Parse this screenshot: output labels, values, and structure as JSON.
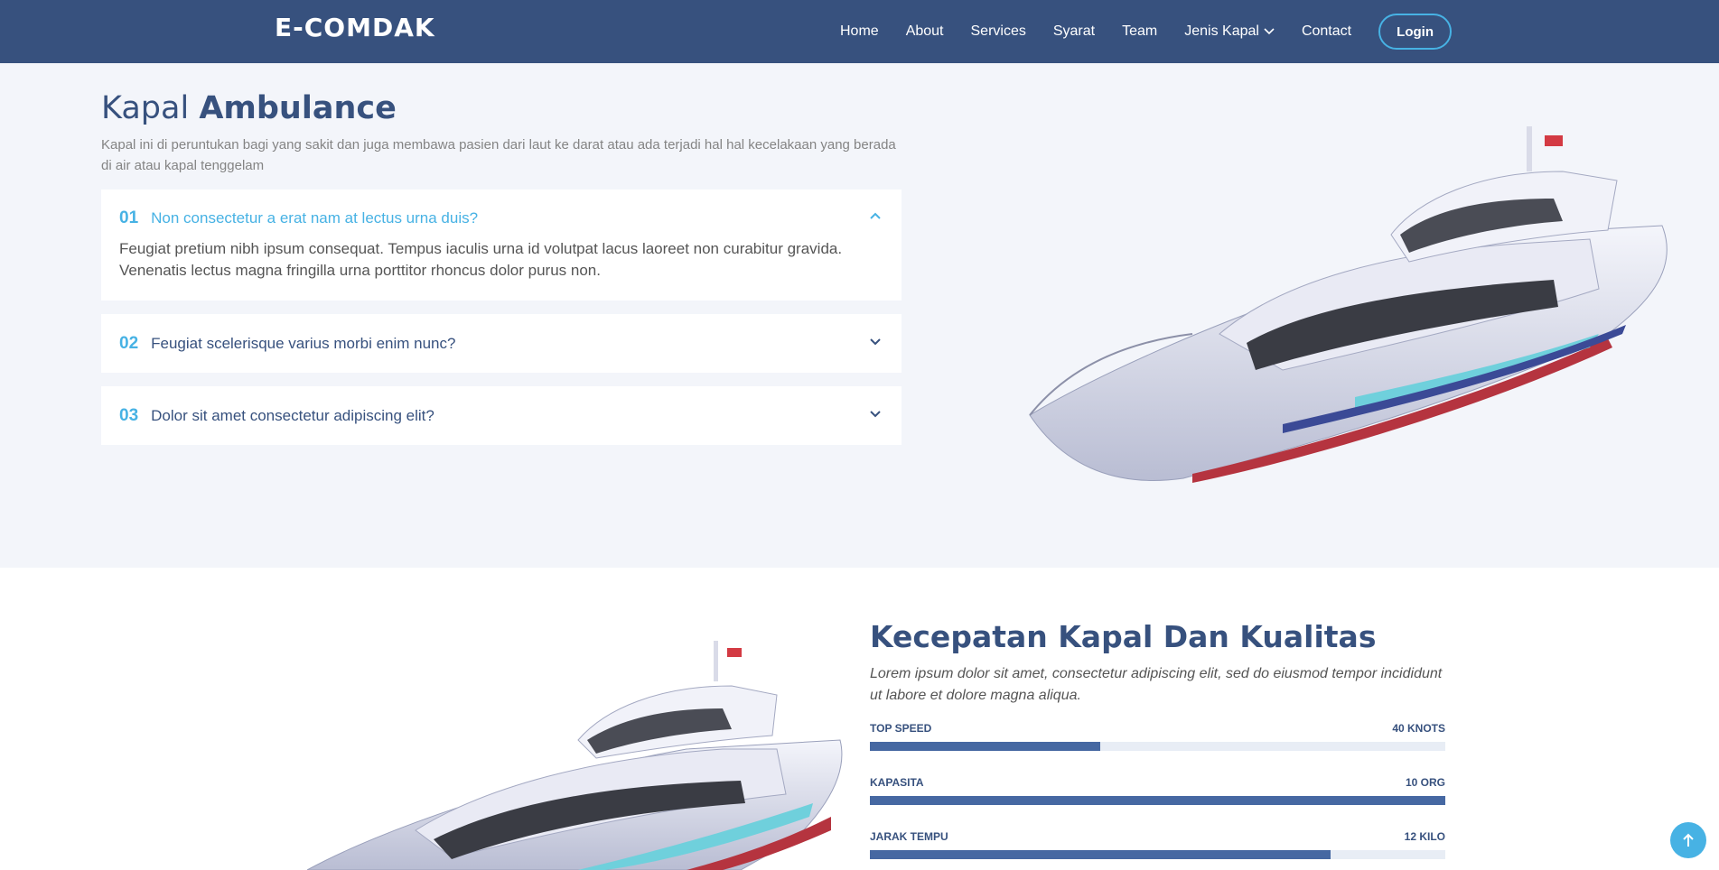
{
  "header": {
    "logo": "E-COMDAK",
    "nav": [
      "Home",
      "About",
      "Services",
      "Syarat",
      "Team",
      "Jenis Kapal",
      "Contact"
    ],
    "login": "Login"
  },
  "section1": {
    "title_light": "Kapal ",
    "title_bold": "Ambulance",
    "description": "Kapal ini di peruntukan bagi yang sakit dan juga membawa pasien dari laut ke darat atau ada terjadi hal hal kecelakaan yang berada di air atau kapal tenggelam",
    "faq": [
      {
        "num": "01",
        "question": "Non consectetur a erat nam at lectus urna duis?",
        "answer": "Feugiat pretium nibh ipsum consequat. Tempus iaculis urna id volutpat lacus laoreet non curabitur gravida. Venenatis lectus magna fringilla urna porttitor rhoncus dolor purus non."
      },
      {
        "num": "02",
        "question": "Feugiat scelerisque varius morbi enim nunc?"
      },
      {
        "num": "03",
        "question": "Dolor sit amet consectetur adipiscing elit?"
      }
    ]
  },
  "section2": {
    "title": "Kecepatan Kapal Dan Kualitas",
    "description": "Lorem ipsum dolor sit amet, consectetur adipiscing elit, sed do eiusmod tempor incididunt ut labore et dolore magna aliqua.",
    "skills": [
      {
        "label": "TOP SPEED",
        "value": "40 KNOTS",
        "percent": 40
      },
      {
        "label": "KAPASITA",
        "value": "10 ORG",
        "percent": 100
      },
      {
        "label": "JARAK TEMPU",
        "value": "12 KILO",
        "percent": 80
      }
    ]
  },
  "colors": {
    "header": "#37517e",
    "accent": "#47b2e4",
    "bar": "#4668a2"
  },
  "icons": {
    "dropdown": "chevron-down-icon",
    "expanded": "chevron-up-icon",
    "scroll_top": "arrow-up-icon"
  }
}
